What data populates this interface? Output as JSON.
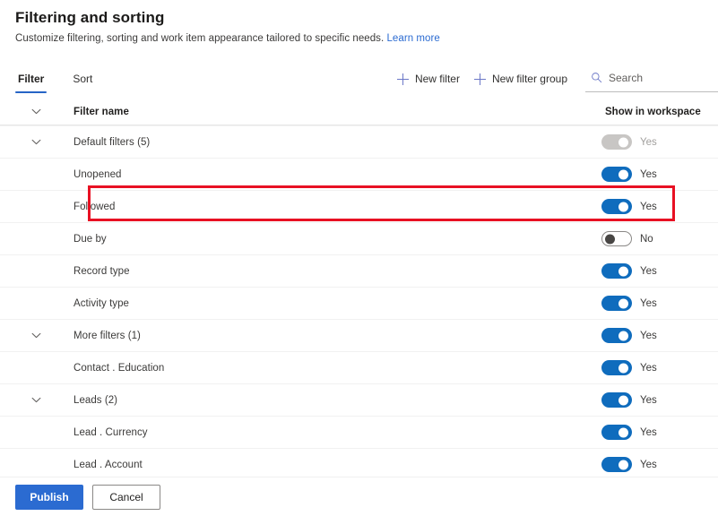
{
  "header": {
    "title": "Filtering and sorting",
    "subtitle": "Customize filtering, sorting and work item appearance tailored to specific needs.",
    "learn_more": "Learn more"
  },
  "tabs": [
    {
      "label": "Filter",
      "active": true
    },
    {
      "label": "Sort",
      "active": false
    }
  ],
  "commands": {
    "new_filter": "New filter",
    "new_filter_group": "New filter group",
    "search_placeholder": "Search",
    "search_value": ""
  },
  "table": {
    "columns": {
      "name": "Filter name",
      "workspace": "Show in workspace"
    },
    "rows": [
      {
        "label": "Default filters (5)",
        "type": "group",
        "expanded": true,
        "toggle": "on",
        "toggle_label": "Yes",
        "disabled": true
      },
      {
        "label": "Unopened",
        "type": "item",
        "expanded": false,
        "toggle": "on",
        "toggle_label": "Yes",
        "disabled": false
      },
      {
        "label": "Followed",
        "type": "item",
        "expanded": false,
        "toggle": "on",
        "toggle_label": "Yes",
        "disabled": false
      },
      {
        "label": "Due by",
        "type": "item",
        "expanded": false,
        "toggle": "off",
        "toggle_label": "No",
        "disabled": false,
        "highlighted": true
      },
      {
        "label": "Record type",
        "type": "item",
        "expanded": false,
        "toggle": "on",
        "toggle_label": "Yes",
        "disabled": false
      },
      {
        "label": "Activity type",
        "type": "item",
        "expanded": false,
        "toggle": "on",
        "toggle_label": "Yes",
        "disabled": false
      },
      {
        "label": "More filters (1)",
        "type": "group",
        "expanded": true,
        "toggle": "on",
        "toggle_label": "Yes",
        "disabled": false
      },
      {
        "label": "Contact . Education",
        "type": "item",
        "expanded": false,
        "toggle": "on",
        "toggle_label": "Yes",
        "disabled": false
      },
      {
        "label": "Leads (2)",
        "type": "group",
        "expanded": true,
        "toggle": "on",
        "toggle_label": "Yes",
        "disabled": false
      },
      {
        "label": "Lead . Currency",
        "type": "item",
        "expanded": false,
        "toggle": "on",
        "toggle_label": "Yes",
        "disabled": false
      },
      {
        "label": "Lead . Account",
        "type": "item",
        "expanded": false,
        "toggle": "on",
        "toggle_label": "Yes",
        "disabled": false
      }
    ]
  },
  "footer": {
    "publish": "Publish",
    "cancel": "Cancel"
  },
  "colors": {
    "accent": "#2b6bd1",
    "toggle_on": "#0f6cbd",
    "toggle_disabled": "#c8c6c4",
    "highlight": "#e81123",
    "link": "#2b6bd1",
    "icon_blue": "#6b77c7"
  },
  "icons": {
    "add": "plus-icon",
    "search": "search-icon",
    "expand": "chevron-down-icon"
  }
}
